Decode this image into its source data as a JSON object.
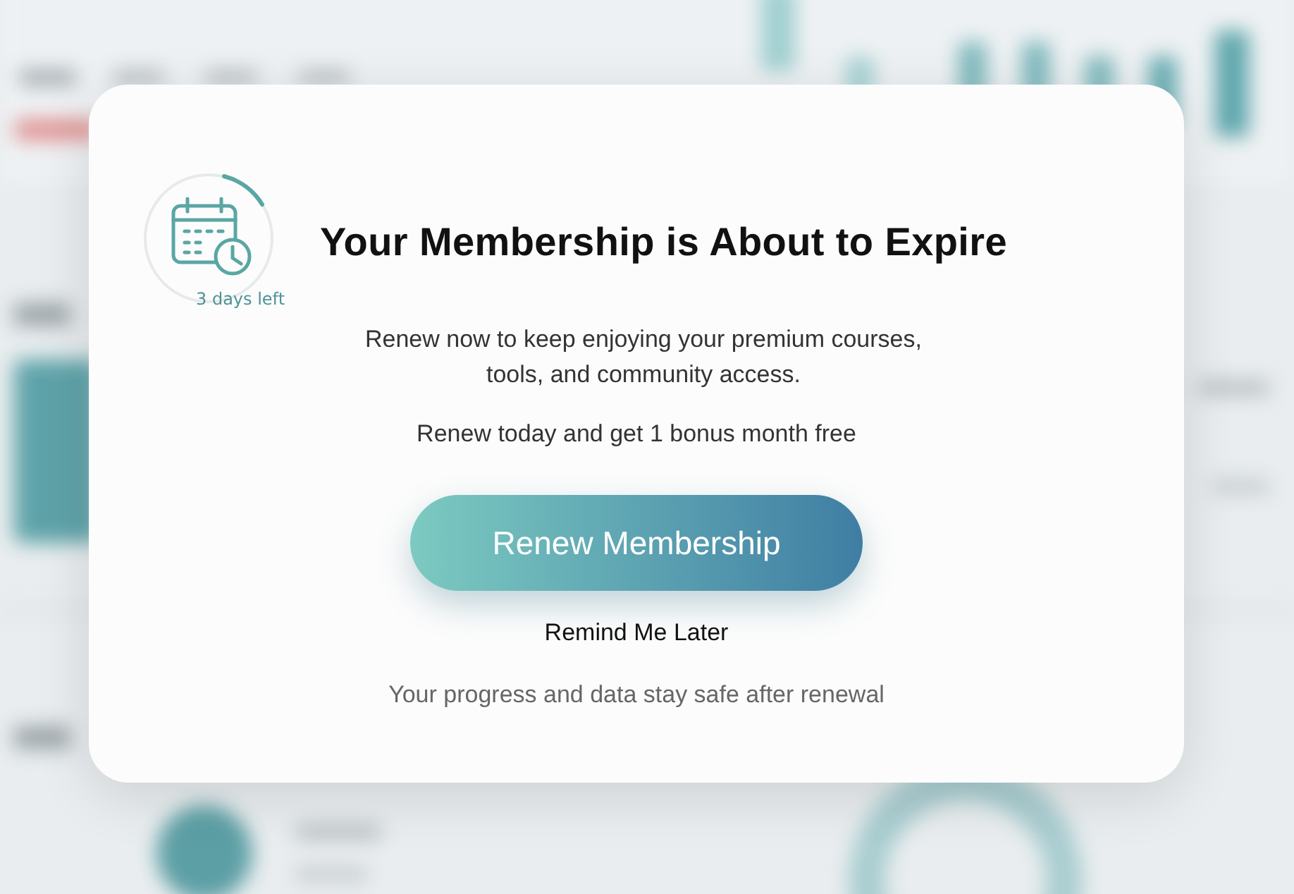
{
  "dialog": {
    "countdown": "3 days left",
    "title": "Your Membership is About to Expire",
    "message": "Renew now to keep enjoying your premium courses, tools, and community access.",
    "offer": "Renew today and get 1 bonus month free",
    "primary_button": "Renew Membership",
    "secondary_link": "Remind Me Later",
    "footnote": "Your progress and data stay safe after renewal"
  }
}
